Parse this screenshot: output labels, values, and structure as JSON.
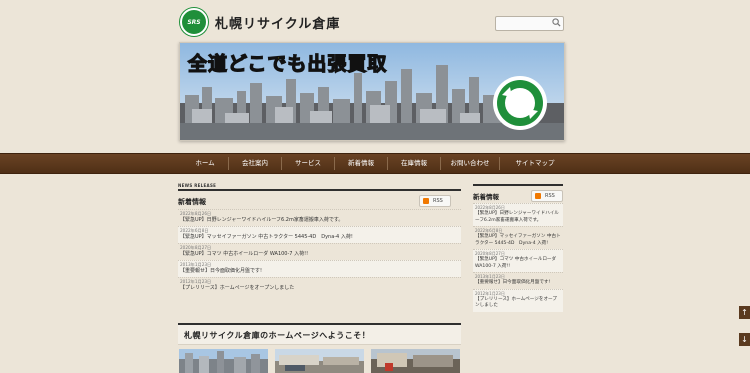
{
  "site": {
    "title": "札幌リサイクル倉庫",
    "logo_text": "SRS",
    "banner_title": "全道どこでも出張買取",
    "banner_logo_text": "SRS"
  },
  "search": {
    "placeholder": "",
    "icon": "search-icon"
  },
  "nav": {
    "items": [
      "ホーム",
      "会社案内",
      "サービス",
      "新着情報",
      "在庫情報",
      "お問い合わせ",
      "サイトマップ"
    ]
  },
  "main_news": {
    "small_heading": "NEWS RELEASE",
    "title": "新着情報",
    "rss_label": "RSS",
    "items": [
      {
        "date": "2022年8月26日",
        "text": "【緊急UP】日野レンジャーワイドハイルーフ6.2m家畜運搬車入荷です。"
      },
      {
        "date": "2022年6月8日",
        "text": "【緊急UP】マッセイファーガソン 中古トラクター 5445-4D　Dyna-4 入荷!"
      },
      {
        "date": "2020年8月27日",
        "text": "【緊急UP】コマツ 中古ホイールローダ WA100-7 入荷!!"
      },
      {
        "date": "2013年1月23日",
        "text": "【重要報せ】日今面取価化月盤です!"
      },
      {
        "date": "2012年1月23日",
        "text": "【プレリリース】ホームページをオープンしました"
      }
    ]
  },
  "welcome": {
    "title": "札幌リサイクル倉庫のホームページへようこそ！"
  },
  "side_news": {
    "title": "新着情報",
    "rss_label": "RSS",
    "items": [
      {
        "date": "2022年8月26日",
        "text": "【緊急UP】日野レンジャーワイドハイルーフ6.2m家畜運搬車入荷です。"
      },
      {
        "date": "2022年6月8日",
        "text": "【緊急UP】マッセイファーガソン 中古トラクター 5445-4D　Dyna-4 入荷!"
      },
      {
        "date": "2020年8月27日",
        "text": "【緊急UP】コマツ 中古ホイールローダ WA100-7 入荷!!"
      },
      {
        "date": "2013年1月23日",
        "text": "【重要報せ】日今面取価化月盤です!"
      },
      {
        "date": "2012年1月23日",
        "text": "【プレリリース】ホームページをオープンしました"
      }
    ]
  },
  "scroll": {
    "up": "↑",
    "down": "↓"
  },
  "colors": {
    "nav_brown": "#5c391c",
    "logo_green": "#1f8f3a",
    "rss_orange": "#f07800",
    "background": "#ece5d8"
  }
}
